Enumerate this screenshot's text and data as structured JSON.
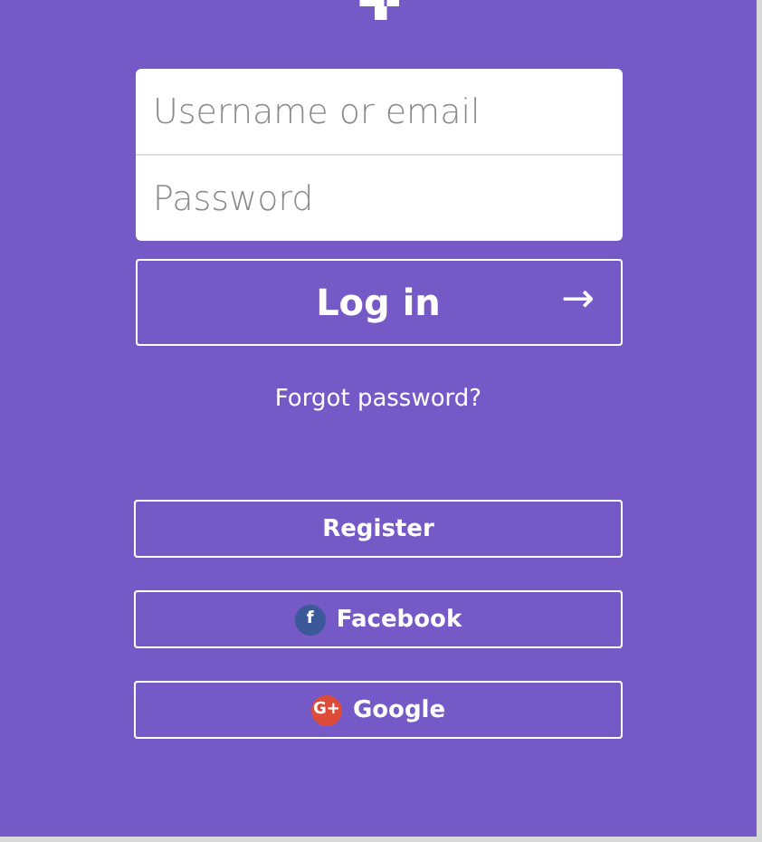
{
  "login_form": {
    "username": {
      "placeholder": "Username or email"
    },
    "password": {
      "placeholder": "Password"
    },
    "login_button": {
      "label": "Log in",
      "arrow": "→"
    },
    "forgot_link": "Forgot password?"
  },
  "account_buttons": [
    {
      "kind": "plain",
      "label": "Register"
    },
    {
      "kind": "facebook",
      "label": "Facebook",
      "icon_text": "f"
    },
    {
      "kind": "google",
      "label": "Google",
      "icon_text": "G+"
    }
  ]
}
